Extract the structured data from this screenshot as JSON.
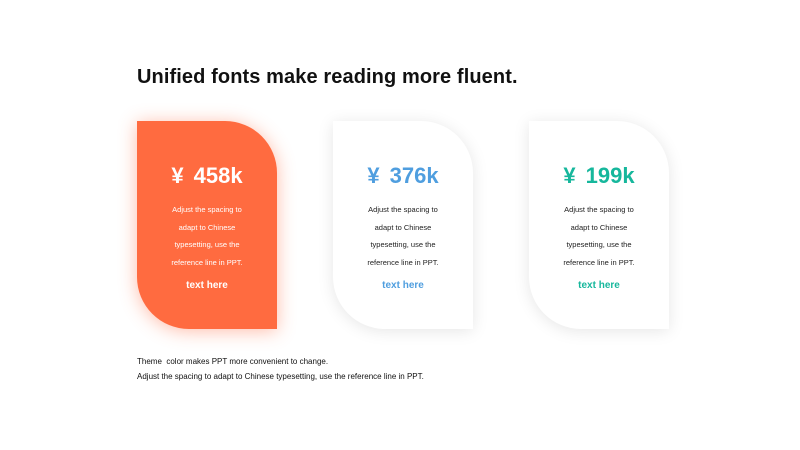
{
  "title": "Unified fonts make reading more fluent.",
  "theme": {
    "accent_orange": "#ff6b40",
    "accent_blue": "#4f9edf",
    "accent_teal": "#16b79c"
  },
  "cards": [
    {
      "currency": "¥",
      "amount": "458k",
      "desc_lines": [
        "Adjust the spacing to",
        "adapt to Chinese",
        "typesetting, use the",
        "reference line in PPT."
      ],
      "link": "text here",
      "color": "#ffffff"
    },
    {
      "currency": "¥",
      "amount": "376k",
      "desc_lines": [
        "Adjust the spacing to",
        "adapt to Chinese",
        "typesetting, use the",
        "reference line in PPT."
      ],
      "link": "text here",
      "color": "#4f9edf"
    },
    {
      "currency": "¥",
      "amount": "199k",
      "desc_lines": [
        "Adjust the spacing to",
        "adapt to Chinese",
        "typesetting, use the",
        "reference line in PPT."
      ],
      "link": "text here",
      "color": "#16b79c"
    }
  ],
  "footer": {
    "line1": "Theme  color makes PPT more convenient to change.",
    "line2": "Adjust the spacing to adapt to Chinese typesetting, use the reference line in PPT."
  }
}
